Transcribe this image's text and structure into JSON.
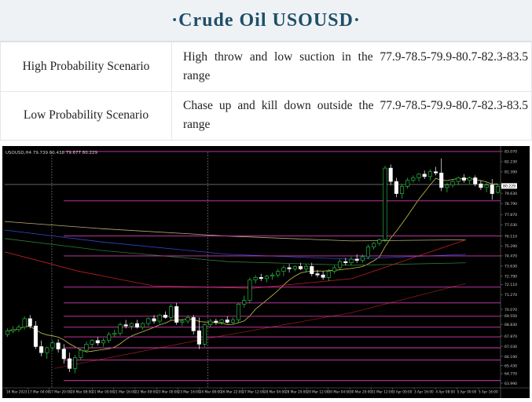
{
  "header": {
    "title": "·Crude  Oil  USOUSD·"
  },
  "scenarios": [
    {
      "label": "High Probability Scenario",
      "text": "High throw and low suction in the 77.9-78.5-79.9-80.7-82.3-83.5 range"
    },
    {
      "label": "Low Probability Scenario",
      "text": "Chase up and kill down outside the 77.9-78.5-79.9-80.7-82.3-83.5 range"
    }
  ],
  "chart_data": {
    "type": "candlestick",
    "title": "USOUSD,H4  79.739 80.438 79.677 80.229",
    "ylim": [
      63.99,
      83.0
    ],
    "current_price": 80.229,
    "price_ticks": [
      "83.070",
      "82.230",
      "81.390",
      "80.229",
      "79.630",
      "78.790",
      "77.870",
      "77.030",
      "76.110",
      "75.290",
      "74.470",
      "73.630",
      "72.790",
      "72.110",
      "71.270",
      "70.070",
      "69.550",
      "68.830",
      "67.870",
      "67.030",
      "66.190",
      "65.430",
      "64.770",
      "63.990"
    ],
    "time_labels": [
      "16 Mar 2023",
      "17 Mar 04:00",
      "17 Mar 20:00",
      "20 Mar 08:00",
      "21 Mar 00:00",
      "21 Mar 16:00",
      "22 Mar 08:00",
      "23 Mar 00:00",
      "23 Mar 16:00",
      "24 Mar 08:00",
      "26 Mar 22:00",
      "27 Mar 12:00",
      "28 Mar 04:00",
      "28 Mar 20:00",
      "29 Mar 12:00",
      "30 Mar 04:00",
      "30 Mar 20:00",
      "31 Mar 12:00",
      "3 Apr 00:00",
      "3 Apr 16:00",
      "4 Apr 08:00",
      "5 Apr 00:00",
      "5 Apr 16:00"
    ],
    "horizontal_levels": [
      83.07,
      79.0,
      76.11,
      74.47,
      71.9,
      70.6,
      69.5,
      68.6,
      67.8,
      66.9,
      65.9,
      64.2
    ],
    "candles": [
      [
        68.0,
        68.5,
        67.8,
        68.3
      ],
      [
        68.3,
        68.7,
        68.1,
        68.4
      ],
      [
        68.4,
        68.8,
        68.2,
        68.6
      ],
      [
        68.6,
        69.5,
        68.4,
        69.3
      ],
      [
        69.3,
        69.6,
        68.5,
        68.7
      ],
      [
        68.7,
        69.1,
        66.8,
        67.0
      ],
      [
        67.0,
        67.5,
        66.2,
        66.5
      ],
      [
        66.5,
        67.0,
        66.0,
        66.9
      ],
      [
        66.9,
        67.5,
        66.7,
        67.3
      ],
      [
        67.3,
        67.6,
        66.5,
        66.8
      ],
      [
        66.8,
        67.2,
        65.6,
        66.0
      ],
      [
        66.0,
        66.5,
        64.9,
        65.2
      ],
      [
        65.2,
        66.3,
        64.8,
        66.1
      ],
      [
        66.1,
        66.8,
        65.9,
        66.7
      ],
      [
        66.7,
        67.4,
        66.5,
        67.2
      ],
      [
        67.2,
        67.6,
        66.9,
        67.5
      ],
      [
        67.5,
        67.8,
        67.1,
        67.3
      ],
      [
        67.3,
        67.7,
        67.0,
        67.5
      ],
      [
        67.5,
        68.2,
        67.3,
        68.0
      ],
      [
        68.0,
        68.4,
        67.8,
        68.1
      ],
      [
        68.1,
        69.0,
        67.9,
        68.8
      ],
      [
        68.8,
        69.2,
        68.5,
        68.7
      ],
      [
        68.7,
        69.0,
        68.4,
        68.9
      ],
      [
        68.9,
        69.2,
        68.5,
        68.6
      ],
      [
        68.6,
        69.0,
        68.4,
        68.9
      ],
      [
        68.9,
        69.4,
        68.7,
        69.3
      ],
      [
        69.3,
        69.6,
        68.9,
        69.1
      ],
      [
        69.1,
        69.7,
        68.9,
        69.6
      ],
      [
        69.6,
        69.9,
        69.3,
        69.4
      ],
      [
        69.4,
        70.5,
        69.2,
        70.3
      ],
      [
        70.3,
        70.6,
        68.8,
        69.0
      ],
      [
        69.0,
        69.3,
        68.7,
        69.1
      ],
      [
        69.1,
        69.6,
        68.9,
        69.4
      ],
      [
        69.4,
        69.6,
        68.0,
        68.3
      ],
      [
        68.3,
        69.4,
        66.8,
        67.2
      ],
      [
        67.2,
        68.9,
        67.0,
        68.8
      ],
      [
        68.8,
        69.3,
        68.6,
        69.1
      ],
      [
        69.1,
        69.3,
        68.8,
        69.0
      ],
      [
        69.0,
        69.3,
        68.8,
        69.2
      ],
      [
        69.2,
        69.5,
        68.9,
        69.0
      ],
      [
        69.0,
        69.4,
        68.8,
        69.2
      ],
      [
        69.2,
        70.6,
        69.0,
        70.5
      ],
      [
        70.5,
        71.2,
        70.2,
        70.8
      ],
      [
        70.8,
        72.7,
        70.6,
        72.5
      ],
      [
        72.5,
        72.9,
        72.2,
        72.7
      ],
      [
        72.7,
        73.0,
        72.4,
        72.6
      ],
      [
        72.6,
        72.9,
        72.3,
        72.8
      ],
      [
        72.8,
        73.1,
        72.5,
        72.9
      ],
      [
        72.9,
        73.4,
        72.7,
        73.2
      ],
      [
        73.2,
        73.7,
        72.8,
        73.5
      ],
      [
        73.5,
        73.8,
        73.1,
        73.4
      ],
      [
        73.4,
        73.7,
        73.2,
        73.6
      ],
      [
        73.6,
        73.9,
        73.3,
        73.4
      ],
      [
        73.4,
        73.8,
        73.1,
        73.6
      ],
      [
        73.6,
        73.9,
        72.8,
        73.0
      ],
      [
        73.0,
        73.3,
        72.7,
        72.9
      ],
      [
        72.9,
        73.2,
        72.5,
        72.7
      ],
      [
        72.7,
        73.4,
        72.4,
        73.2
      ],
      [
        73.2,
        73.7,
        73.0,
        73.5
      ],
      [
        73.5,
        74.2,
        73.3,
        74.0
      ],
      [
        74.0,
        74.3,
        73.7,
        73.9
      ],
      [
        73.9,
        74.4,
        73.7,
        74.2
      ],
      [
        74.2,
        74.6,
        73.9,
        74.1
      ],
      [
        74.1,
        74.6,
        73.9,
        74.4
      ],
      [
        74.4,
        75.4,
        74.2,
        75.2
      ],
      [
        75.2,
        75.6,
        75.0,
        75.5
      ],
      [
        75.5,
        75.9,
        75.3,
        75.8
      ],
      [
        75.8,
        81.9,
        75.6,
        81.7
      ],
      [
        81.7,
        82.0,
        80.3,
        80.6
      ],
      [
        80.6,
        80.9,
        79.3,
        79.6
      ],
      [
        79.6,
        80.4,
        79.2,
        80.2
      ],
      [
        80.2,
        80.9,
        80.0,
        80.7
      ],
      [
        80.7,
        81.1,
        80.5,
        80.9
      ],
      [
        80.9,
        81.3,
        80.6,
        81.2
      ],
      [
        81.2,
        81.5,
        80.8,
        81.0
      ],
      [
        81.0,
        81.6,
        80.7,
        81.4
      ],
      [
        81.4,
        81.8,
        81.1,
        81.3
      ],
      [
        81.3,
        82.5,
        79.8,
        80.1
      ],
      [
        80.1,
        80.5,
        79.7,
        80.3
      ],
      [
        80.3,
        80.8,
        80.1,
        80.6
      ],
      [
        80.6,
        81.0,
        80.3,
        80.9
      ],
      [
        80.9,
        81.2,
        80.5,
        80.7
      ],
      [
        80.7,
        81.0,
        80.4,
        80.9
      ],
      [
        80.9,
        81.1,
        80.2,
        80.4
      ],
      [
        80.4,
        80.7,
        79.9,
        80.1
      ],
      [
        80.1,
        80.5,
        79.7,
        80.3
      ],
      [
        80.3,
        80.8,
        79.1,
        79.6
      ],
      [
        79.7,
        80.4,
        79.6,
        80.2
      ]
    ]
  }
}
